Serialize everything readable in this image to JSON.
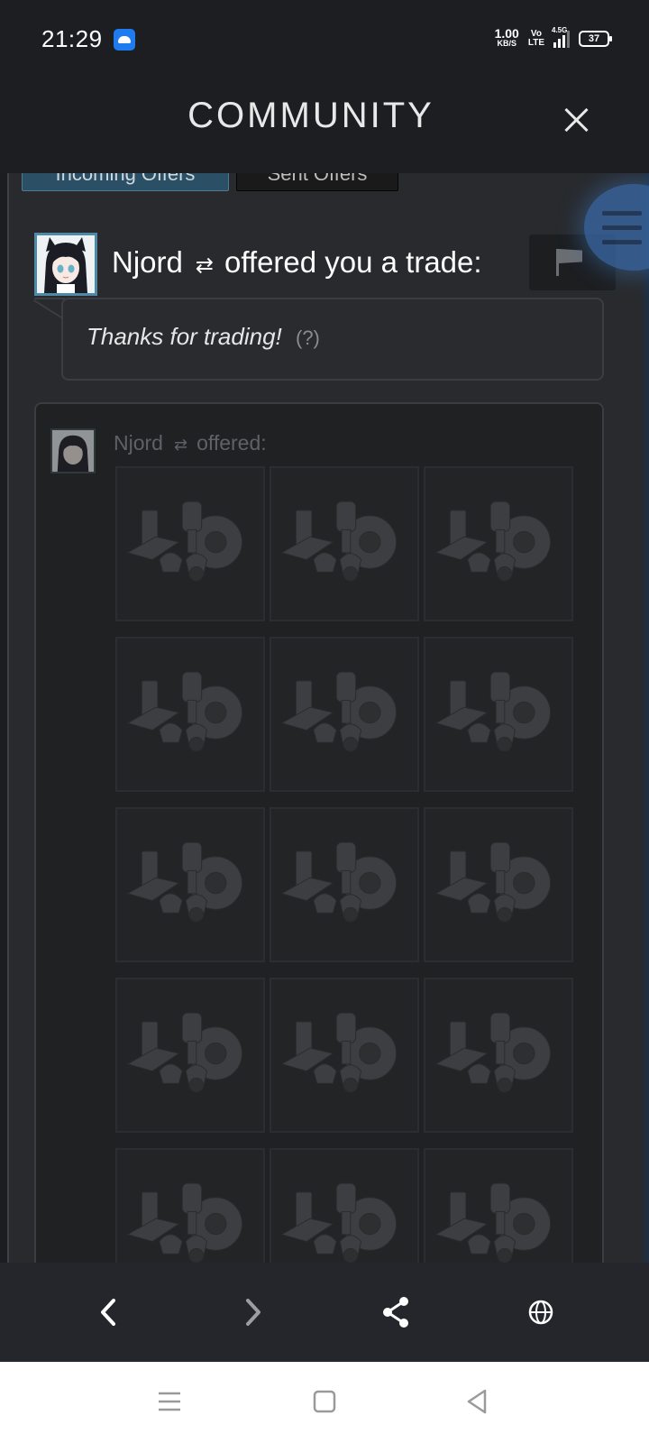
{
  "status_bar": {
    "time": "21:29",
    "net_speed_value": "1.00",
    "net_speed_unit": "KB/S",
    "volte": "Vo\nLTE",
    "network": "4.5G",
    "battery": "37"
  },
  "header": {
    "title": "COMMUNITY"
  },
  "tabs": {
    "incoming": "Incoming Offers",
    "sent": "Sent Offers"
  },
  "offer": {
    "partner_name": "Njord",
    "swap_symbol": "⇄",
    "action_text": "offered you a trade:",
    "message": "Thanks for trading!",
    "help": "(?)"
  },
  "items_section": {
    "partner_name": "Njord",
    "swap_symbol": "⇄",
    "label": "offered:",
    "item_icon": "gears-pistons-icon",
    "item_count_visible": 15
  },
  "colors": {
    "background": "#1b1d21",
    "panel": "#282a2d",
    "accent": "#2b5066",
    "avatar_border": "#4d8aa8"
  },
  "icons": {
    "close": "close-icon",
    "flag": "flag-icon",
    "back": "chevron-left-icon",
    "forward": "chevron-right-icon",
    "share": "share-icon",
    "browser": "globe-icon",
    "nav_menu": "menu-icon",
    "nav_home": "square-icon",
    "nav_back": "triangle-back-icon"
  }
}
